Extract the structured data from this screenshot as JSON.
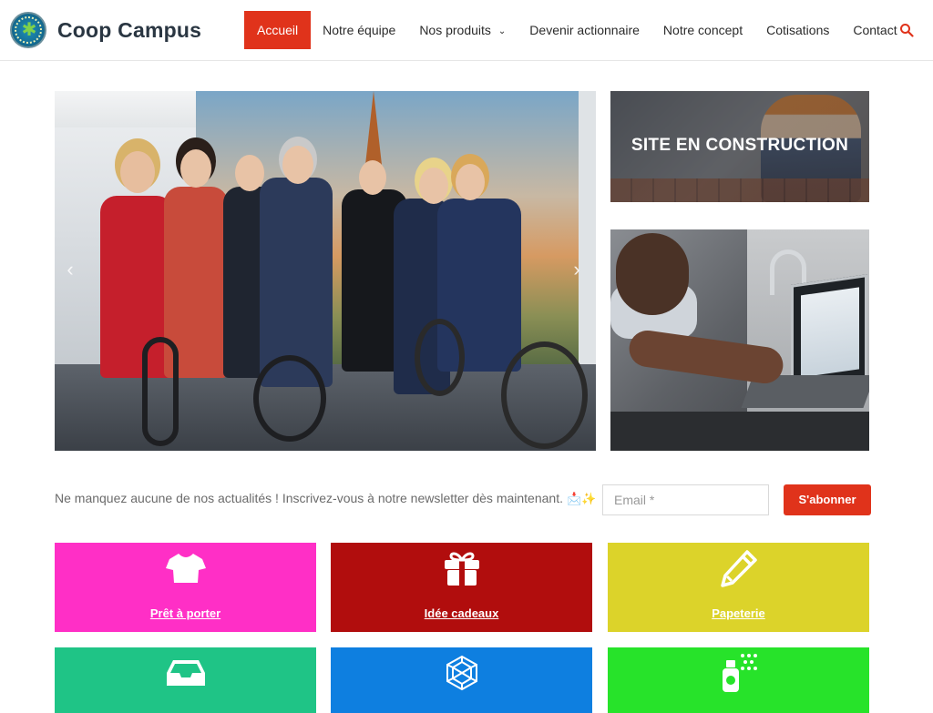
{
  "header": {
    "site_title": "Coop Campus",
    "logo_icon": "coop-campus-logo",
    "nav": [
      {
        "label": "Accueil",
        "active": true
      },
      {
        "label": "Notre équipe"
      },
      {
        "label": "Nos produits",
        "has_dropdown": true
      },
      {
        "label": "Devenir actionnaire"
      },
      {
        "label": "Notre concept"
      },
      {
        "label": "Cotisations"
      },
      {
        "label": "Contact"
      }
    ],
    "search_icon": "search-icon",
    "accent_color": "#e0331b"
  },
  "hero": {
    "prev_icon": "‹",
    "next_icon": "›"
  },
  "side_cards": {
    "construction_label": "SITE EN CONSTRUCTION"
  },
  "newsletter": {
    "text": "Ne manquez aucune de nos actualités ! Inscrivez-vous à notre newsletter dès maintenant.",
    "emoji": "📩✨",
    "email_placeholder": "Email *",
    "subscribe_label": "S'abonner"
  },
  "categories": [
    {
      "label": "Prêt à porter",
      "icon": "tshirt-icon",
      "color": "#ff2fc6"
    },
    {
      "label": "Idée cadeaux",
      "icon": "gift-icon",
      "color": "#b10d0d"
    },
    {
      "label": "Papeterie",
      "icon": "pencil-icon",
      "color": "#dcd32a"
    },
    {
      "label": "",
      "icon": "inbox-tray-icon",
      "color": "#1fc486"
    },
    {
      "label": "",
      "icon": "polyhedron-icon",
      "color": "#0e7fe0"
    },
    {
      "label": "",
      "icon": "spray-bottle-icon",
      "color": "#27e32a"
    }
  ]
}
